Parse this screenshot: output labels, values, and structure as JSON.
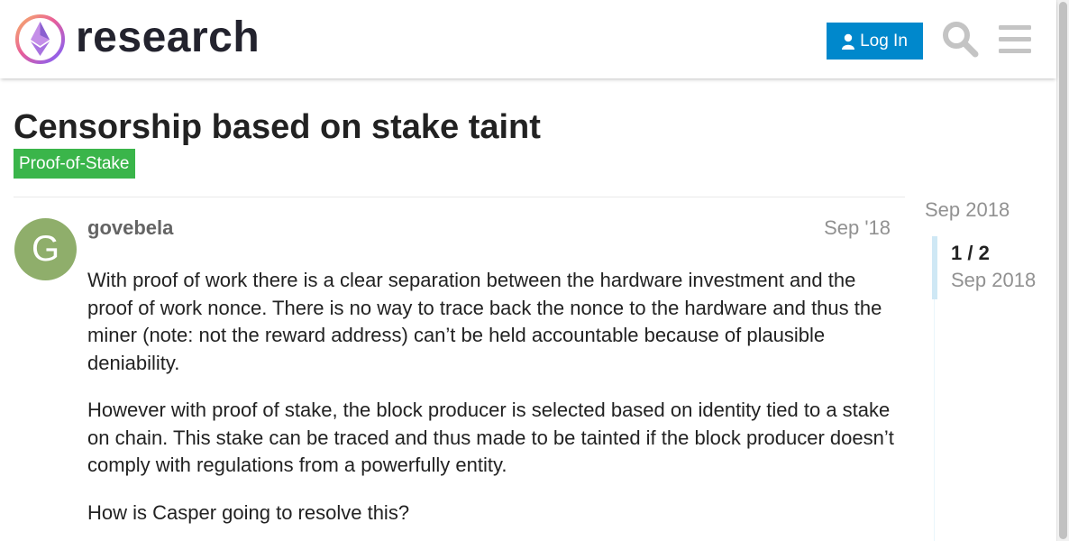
{
  "header": {
    "brand": "research",
    "login_label": "Log In"
  },
  "topic": {
    "title": "Censorship based on stake taint",
    "category": "Proof-of-Stake",
    "category_color": "#3ab54a"
  },
  "post": {
    "avatar_letter": "G",
    "avatar_color": "#8fae6b",
    "username": "govebela",
    "date": "Sep '18",
    "paragraphs": [
      "With proof of work there is a clear separation between the hardware investment and the proof of work nonce. There is no way to trace back the nonce to the hardware and thus the miner (note: not the reward address) can’t be held accountable because of plausible deniability.",
      "However with proof of stake, the block producer is selected based on identity tied to a stake on chain. This stake can be traced and thus made to be tainted if the block producer doesn’t comply with regulations from a powerfully entity.",
      "How is Casper going to resolve this?"
    ]
  },
  "timeline": {
    "start_date": "Sep 2018",
    "position": "1 / 2",
    "current_date": "Sep 2018"
  },
  "colors": {
    "accent": "#0088cc",
    "muted": "#919191"
  }
}
